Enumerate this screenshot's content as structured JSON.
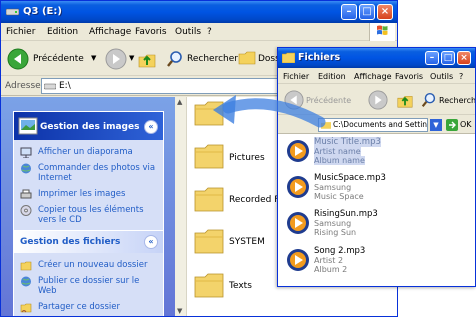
{
  "main_window": {
    "title": "Q3 (E:)",
    "menu": [
      "Fichier",
      "Edition",
      "Affichage",
      "Favoris",
      "Outils",
      "?"
    ],
    "toolbar": {
      "back_label": "Précédente",
      "search_label": "Rechercher",
      "folders_label": "Dossi"
    },
    "address": {
      "label": "Adresse",
      "value": "E:\\"
    },
    "image_tasks": {
      "title": "Gestion des images",
      "items": [
        "Afficher un diaporama",
        "Commander des photos via Internet",
        "Imprimer les images",
        "Copier tous les éléments vers le CD"
      ]
    },
    "file_tasks": {
      "title": "Gestion des fichiers",
      "items": [
        "Créer un nouveau dossier",
        "Publier ce dossier sur le Web",
        "Partager ce dossier"
      ]
    },
    "folders": [
      "",
      "Pictures",
      "Recorded F",
      "SYSTEM",
      "Texts"
    ]
  },
  "sub_window": {
    "title": "Fichiers",
    "menu": [
      "Fichier",
      "Edition",
      "Affichage",
      "Favoris",
      "Outils",
      "?"
    ],
    "toolbar": {
      "back_label": "Précédente",
      "search_label": "Rechercher"
    },
    "address": {
      "value": "C:\\Documents and Settings\\",
      "go_label": "OK"
    },
    "songs": [
      {
        "name": "Music Title.mp3",
        "artist": "Artist name",
        "album": "Album name"
      },
      {
        "name": "MusicSpace.mp3",
        "artist": "Samsung",
        "album": "Music Space"
      },
      {
        "name": "RisingSun.mp3",
        "artist": "Samsung",
        "album": "Rising Sun"
      },
      {
        "name": "Song 2.mp3",
        "artist": "Artist 2",
        "album": "Album 2"
      }
    ]
  },
  "colors": {
    "title_blue": "#0054e3",
    "task_blue": "#215dc6",
    "drag_arrow": "#3d7fe0"
  }
}
